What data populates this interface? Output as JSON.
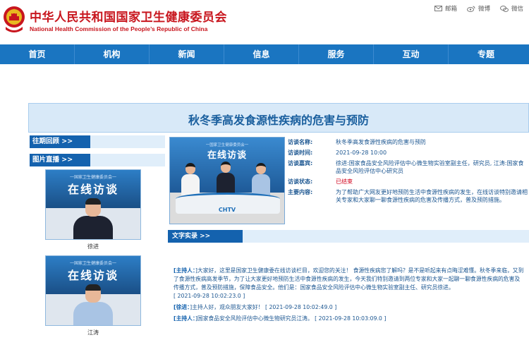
{
  "header": {
    "title_cn": "中华人民共和国国家卫生健康委员会",
    "title_en": "National Health Commission of the People’s Republic of China",
    "links": [
      {
        "icon": "mail-icon",
        "label": "邮箱"
      },
      {
        "icon": "weibo-icon",
        "label": "微博"
      },
      {
        "icon": "wechat-icon",
        "label": "微信"
      }
    ]
  },
  "nav": [
    "首页",
    "机构",
    "新闻",
    "信息",
    "服务",
    "互动",
    "专题"
  ],
  "banner": {
    "title": "秋冬季高发食源性疾病的危害与预防"
  },
  "sidebar": {
    "tab1": "往期回顾 >>",
    "tab2": "图片直播 >>",
    "photos": [
      {
        "top_text": "一国家卫生健康委员会一",
        "big_text": "在线访谈",
        "caption": "徐进"
      },
      {
        "top_text": "一国家卫生健康委员会一",
        "big_text": "在线访谈",
        "caption": "江涛"
      }
    ]
  },
  "video": {
    "top_text": "一国家卫生健康委员会一",
    "big_text": "在线访谈",
    "desk_logo": "CHTV"
  },
  "info": {
    "rows": [
      {
        "label": "访谈名称:",
        "value": "秋冬季高发食源性疾病的危害与预防"
      },
      {
        "label": "访谈时间:",
        "value": "2021-09-28 10:00"
      },
      {
        "label": "访谈嘉宾:",
        "value": "徐进:国家食品安全风险评估中心微生物实验室副主任，研究员, 江涛:国家食品安全风险评估中心研究员"
      },
      {
        "label": "访谈状态:",
        "value": "已结束"
      },
      {
        "label": "主要内容:",
        "value": "为了帮助广大网友更好地预防生活中食源性疾病的发生，在线访谈特别邀请相关专家和大家聊一聊食源性疾病的危害及传播方式，普及预防措施。"
      }
    ],
    "status_color": "#d0021b"
  },
  "transcript": {
    "tab": "文字实录 >>",
    "entries": [
      {
        "speaker": "[主持人：",
        "text": "]大家好，这里是国家卫生健康委在线访谈栏目，欢迎您的关注！ 食源性疾病您了解吗？是不是听起来有点晦涩难懂。秋冬季来临，又到了食源性疾病高发季节，为了让大家更好地预防生活中食源性疾病的发生，今天我们特别邀请到两位专家和大家一起聊一聊食源性疾病的危害及传播方式，普及预防措施，保障食品安全。他们是：国家食品安全风险评估中心微生物实验室副主任、研究员徐进。",
        "time": "[ 2021-09-28 10:02:23.0 ]"
      },
      {
        "speaker": "[徐进：",
        "text": "]主持人好，观众朋友大家好！",
        "time": "[ 2021-09-28 10:02:49.0 ]"
      },
      {
        "speaker": "[主持人：",
        "text": "]国家食品安全风险评估中心微生物研究员江涛。",
        "time": "[ 2021-09-28 10:03:09.0 ]"
      }
    ]
  },
  "colors": {
    "nav": "#1a75c1",
    "brand_red": "#c8161e",
    "tab_blue": "#1462ae"
  }
}
